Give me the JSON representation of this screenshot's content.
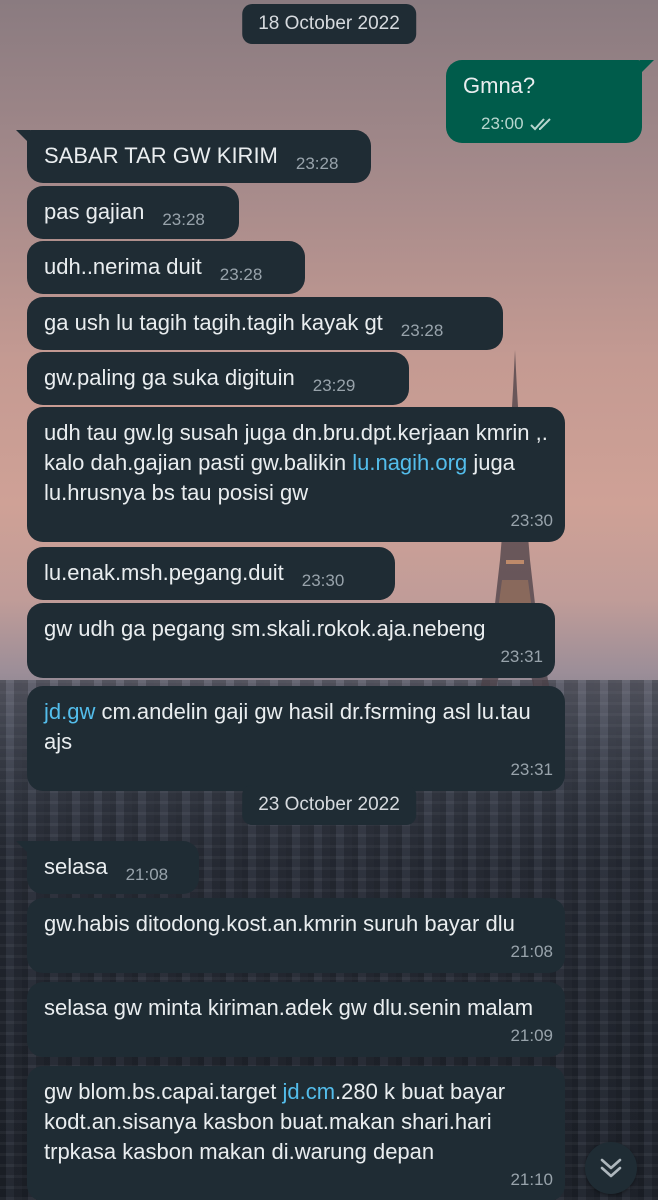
{
  "chat": {
    "date_1": "18 October 2022",
    "date_2": "23 October 2022",
    "messages": [
      {
        "text": "Gmna?",
        "time": "23:00"
      },
      {
        "text": "SABAR TAR GW KIRIM",
        "time": "23:28"
      },
      {
        "text": "pas gajian",
        "time": "23:28"
      },
      {
        "text": "udh..nerima duit",
        "time": "23:28"
      },
      {
        "text": "ga ush lu tagih tagih.tagih kayak gt",
        "time": "23:28"
      },
      {
        "text": "gw.paling ga suka digituin",
        "time": "23:29"
      },
      {
        "text_a": "udh tau gw.lg susah juga dn.bru.dpt.kerjaan kmrin ,. kalo dah.gajian pasti gw.balikin ",
        "link": "lu.nagih.org",
        "text_b": " juga lu.hrusnya bs tau posisi gw",
        "time": "23:30"
      },
      {
        "text": "lu.enak.msh.pegang.duit",
        "time": "23:30"
      },
      {
        "text": "gw udh  ga pegang sm.skali.rokok.aja.nebeng",
        "time": "23:31"
      },
      {
        "link": "jd.gw",
        "text_b": " cm.andelin gaji gw hasil dr.fsrming asl lu.tau ajs",
        "time": "23:31"
      },
      {
        "text": "selasa",
        "time": "21:08"
      },
      {
        "text": "gw.habis ditodong.kost.an.kmrin suruh bayar dlu",
        "time": "21:08"
      },
      {
        "text": "selasa gw minta kiriman.adek gw dlu.senin malam",
        "time": "21:09"
      },
      {
        "text_a": "gw blom.bs.capai.target ",
        "link": "jd.cm",
        "text_b": ".280 k buat bayar kodt.an.sisanya kasbon buat.makan shari.hari trpkasa kasbon makan di.warung depan",
        "time": "21:10"
      }
    ]
  },
  "icons": {
    "read_receipt": "double-check-icon",
    "scroll_down": "double-chevron-down-icon"
  },
  "colors": {
    "incoming_bubble": "#1f2c34",
    "outgoing_bubble": "#005c4b",
    "link": "#53bdeb",
    "timestamp": "#98a3ab"
  }
}
